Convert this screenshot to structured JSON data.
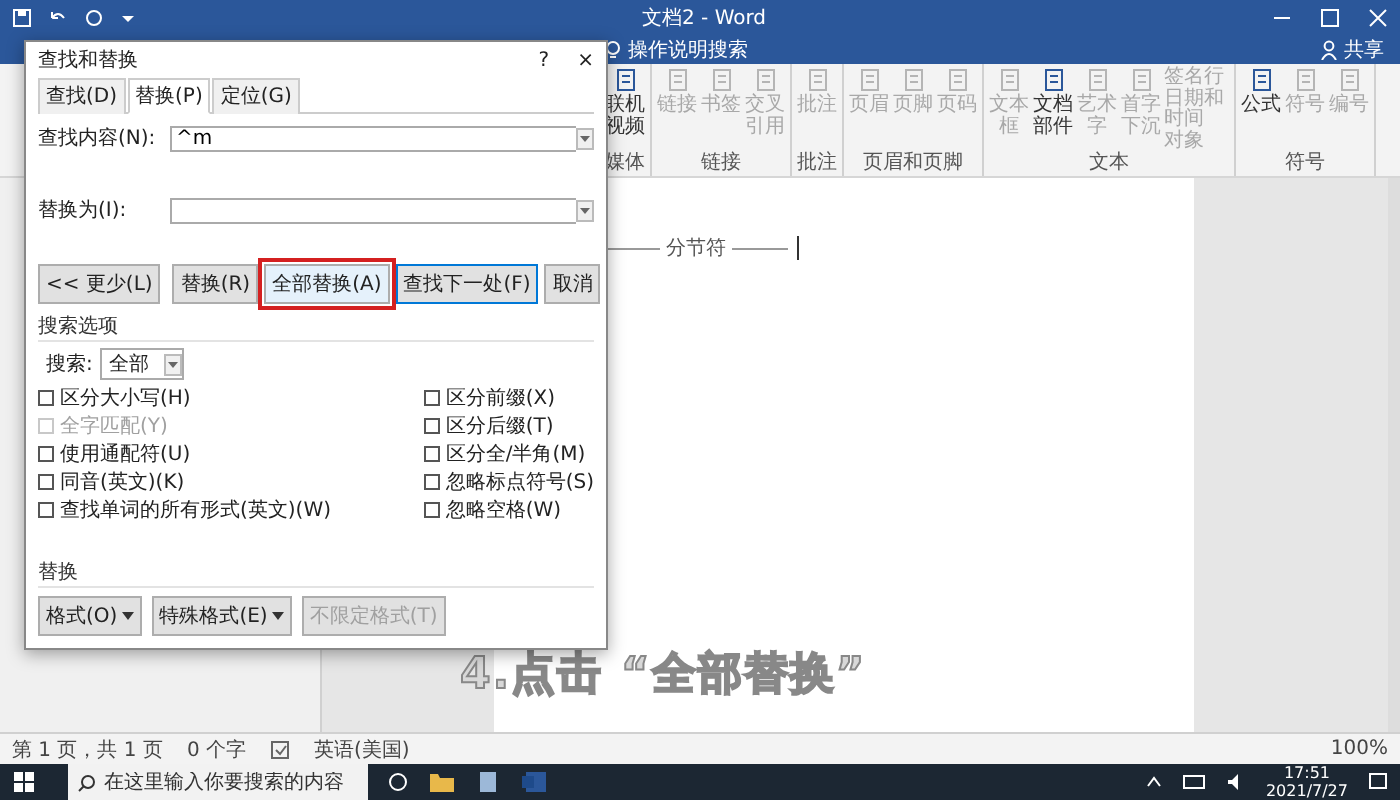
{
  "window": {
    "title": "文档2 - Word"
  },
  "ribbon_bar": {
    "search": "操作说明搜索",
    "share": "共享"
  },
  "ribbon_groups": [
    {
      "label": "媒体",
      "items": [
        {
          "label": "联机视频",
          "disabled": false
        }
      ]
    },
    {
      "label": "链接",
      "items": [
        {
          "label": "链接",
          "disabled": true
        },
        {
          "label": "书签",
          "disabled": true
        },
        {
          "label": "交叉引用",
          "disabled": true
        }
      ]
    },
    {
      "label": "批注",
      "items": [
        {
          "label": "批注",
          "disabled": true
        }
      ]
    },
    {
      "label": "页眉和页脚",
      "items": [
        {
          "label": "页眉",
          "disabled": true
        },
        {
          "label": "页脚",
          "disabled": true
        },
        {
          "label": "页码",
          "disabled": true
        }
      ]
    },
    {
      "label": "文本",
      "items": [
        {
          "label": "文本框",
          "disabled": true
        },
        {
          "label": "文档部件",
          "disabled": false
        },
        {
          "label": "艺术字",
          "disabled": true
        },
        {
          "label": "首字下沉",
          "disabled": true
        }
      ],
      "small_items": [
        {
          "label": "签名行",
          "disabled": true
        },
        {
          "label": "日期和时间",
          "disabled": true
        },
        {
          "label": "对象",
          "disabled": true
        }
      ]
    },
    {
      "label": "符号",
      "items": [
        {
          "label": "公式",
          "disabled": false
        },
        {
          "label": "符号",
          "disabled": true
        },
        {
          "label": "编号",
          "disabled": true
        }
      ]
    }
  ],
  "document": {
    "section_break": "分节符"
  },
  "caption": "4.点击 “全部替换”",
  "status_bar": {
    "items": [
      "第 1 页，共 1 页",
      "0 个字",
      "英语(美国)"
    ],
    "zoom": "100%"
  },
  "taskbar": {
    "search_placeholder": "在这里输入你要搜索的内容",
    "time": "17:51",
    "date": "2021/7/27"
  },
  "dialog": {
    "title": "查找和替换",
    "help": "?",
    "close": "×",
    "tabs": [
      {
        "label": "查找(D)",
        "selected": false
      },
      {
        "label": "替换(P)",
        "selected": true
      },
      {
        "label": "定位(G)",
        "selected": false
      }
    ],
    "find_label": "查找内容(N):",
    "find_value": "^m",
    "replace_label": "替换为(I):",
    "buttons": [
      {
        "label": "<< 更少(L)",
        "highlighted": false,
        "default": false
      },
      {
        "label": "替换(R)",
        "highlighted": false,
        "default": false
      },
      {
        "label": "全部替换(A)",
        "highlighted": true,
        "default": false
      },
      {
        "label": "查找下一处(F)",
        "highlighted": false,
        "default": true
      },
      {
        "label": "取消",
        "highlighted": false,
        "default": false
      }
    ],
    "options_title": "搜索选项",
    "search_label": "搜索:",
    "search_value": "全部",
    "options_left": [
      {
        "label": "区分大小写(H)",
        "checked": false,
        "disabled": false
      },
      {
        "label": "全字匹配(Y)",
        "checked": false,
        "disabled": true
      },
      {
        "label": "使用通配符(U)",
        "checked": false,
        "disabled": false
      },
      {
        "label": "同音(英文)(K)",
        "checked": false,
        "disabled": false
      },
      {
        "label": "查找单词的所有形式(英文)(W)",
        "checked": false,
        "disabled": false
      }
    ],
    "options_right": [
      {
        "label": "区分前缀(X)",
        "checked": false,
        "disabled": false
      },
      {
        "label": "区分后缀(T)",
        "checked": false,
        "disabled": false
      },
      {
        "label": "区分全/半角(M)",
        "checked": false,
        "disabled": false
      },
      {
        "label": "忽略标点符号(S)",
        "checked": false,
        "disabled": false
      },
      {
        "label": "忽略空格(W)",
        "checked": false,
        "disabled": false
      }
    ],
    "replace_title": "替换",
    "format_buttons": [
      {
        "label": "格式(O)",
        "dropdown": true,
        "disabled": false
      },
      {
        "label": "特殊格式(E)",
        "dropdown": true,
        "disabled": false
      },
      {
        "label": "不限定格式(T)",
        "dropdown": false,
        "disabled": true
      }
    ]
  }
}
